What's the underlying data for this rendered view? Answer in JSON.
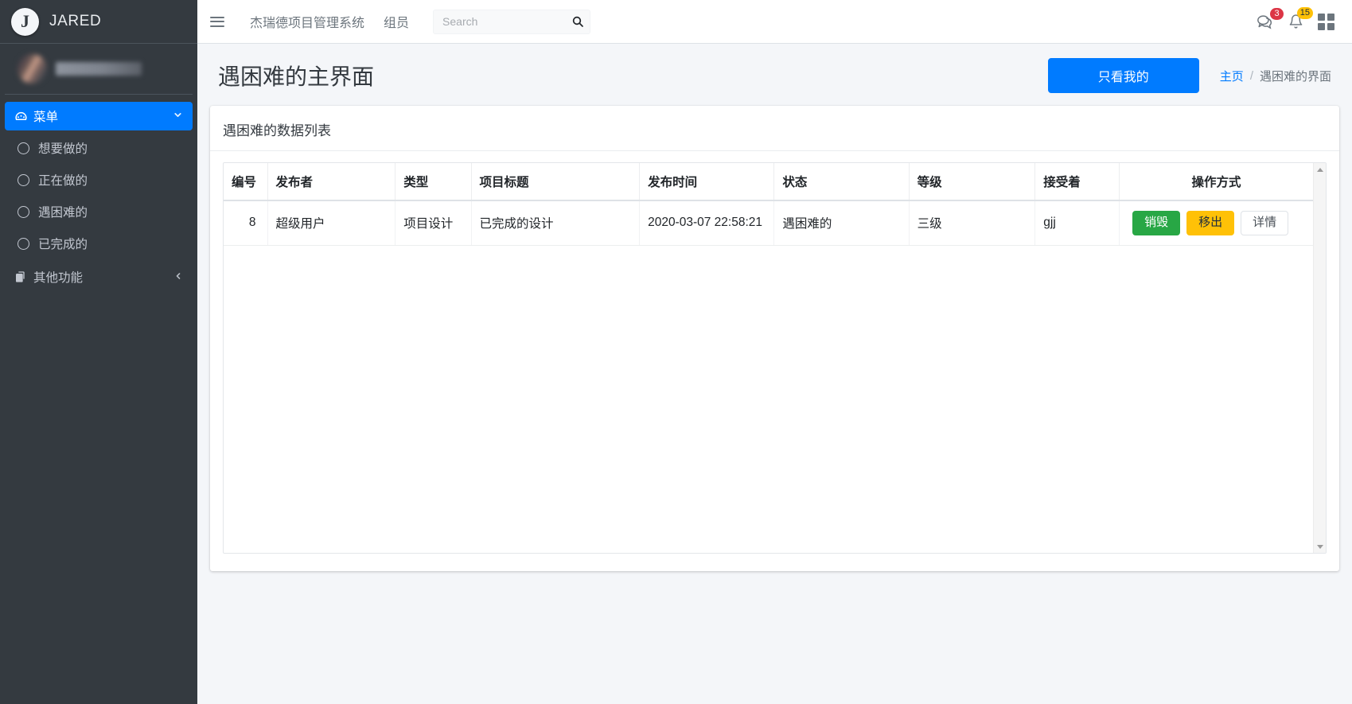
{
  "sidebar": {
    "brand": {
      "logo_letter": "J",
      "name": "JARED"
    },
    "user": {
      "name_redacted": ""
    },
    "menu": {
      "label": "菜单",
      "icon": "dashboard-icon",
      "arrow": "chevron-down-icon"
    },
    "items": [
      {
        "label": "想要做的",
        "icon": "circle-icon"
      },
      {
        "label": "正在做的",
        "icon": "circle-icon"
      },
      {
        "label": "遇困难的",
        "icon": "circle-icon"
      },
      {
        "label": "已完成的",
        "icon": "circle-icon"
      }
    ],
    "other": {
      "label": "其他功能",
      "icon": "copy-icon",
      "arrow": "chevron-left-icon"
    }
  },
  "topbar": {
    "menu_toggle": "hamburger-icon",
    "links": [
      {
        "label": "杰瑞德项目管理系统"
      },
      {
        "label": "组员"
      }
    ],
    "search": {
      "value": "",
      "placeholder": "Search",
      "button_icon": "search-icon"
    },
    "icons": [
      {
        "name": "messages-icon",
        "badge": "3",
        "badge_color": "#dc3545"
      },
      {
        "name": "bell-icon",
        "badge": "15",
        "badge_color": "#ffc107"
      },
      {
        "name": "grid-icon",
        "badge": ""
      }
    ]
  },
  "header": {
    "title": "遇困难的主界面",
    "primary_button": "只看我的",
    "breadcrumb": {
      "home": "主页",
      "separator": "/",
      "current": "遇困难的界面"
    }
  },
  "card": {
    "title": "遇困难的数据列表",
    "table": {
      "columns": [
        "编号",
        "发布者",
        "类型",
        "项目标题",
        "发布时间",
        "状态",
        "等级",
        "接受着",
        "操作方式"
      ],
      "rows": [
        {
          "id": "8",
          "publisher": "超级用户",
          "type": "项目设计",
          "project_title": "已完成的设计",
          "publish_time": "2020-03-07 22:58:21",
          "status": "遇困难的",
          "level": "三级",
          "receiver": "gjj",
          "actions": [
            {
              "label": "销毁",
              "style": "btn-success"
            },
            {
              "label": "移出",
              "style": "btn-warning"
            },
            {
              "label": "详情",
              "style": "btn-light"
            }
          ]
        }
      ]
    },
    "scrollbar": {
      "up": "scroll-up-arrow",
      "down": "scroll-down-arrow"
    }
  },
  "colors": {
    "accent": "#007bff",
    "sidebar_bg": "#343a40",
    "page_bg": "#f4f6f9",
    "success": "#28a745",
    "warning": "#ffc107",
    "danger": "#dc3545"
  }
}
